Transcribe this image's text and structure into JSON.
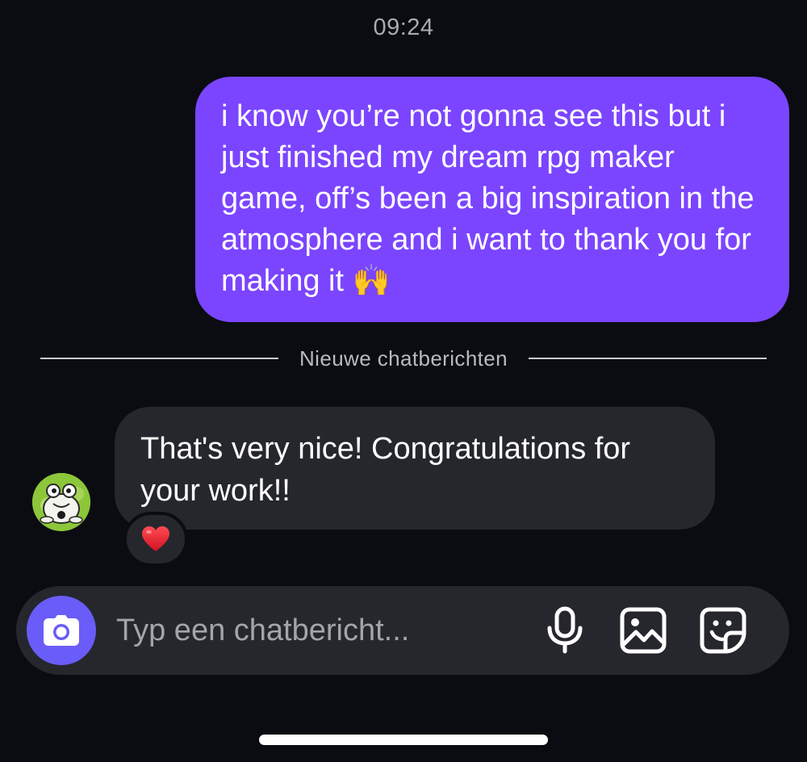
{
  "header": {
    "timestamp": "09:24"
  },
  "messages": {
    "outgoing": {
      "text": "i know you’re not gonna see this but i just finished my dream rpg maker game, off’s been a big inspiration in the atmosphere and i want to thank you for making it 🙌"
    },
    "divider_label": "Nieuwe chatberichten",
    "incoming": {
      "text": "That's very nice! Congratulations for your work!!",
      "reaction": "❤️"
    }
  },
  "composer": {
    "placeholder": "Typ een chatbericht..."
  },
  "icons": {
    "camera": "camera-icon",
    "microphone": "microphone-icon",
    "image": "image-icon",
    "sticker": "sticker-icon",
    "avatar": "frog-avatar"
  },
  "colors": {
    "background": "#0b0c12",
    "outgoing_bubble": "#7b45ff",
    "incoming_bubble": "#25272d",
    "camera_button": "#6a5cf8",
    "reaction_heart": "#e0202e"
  }
}
